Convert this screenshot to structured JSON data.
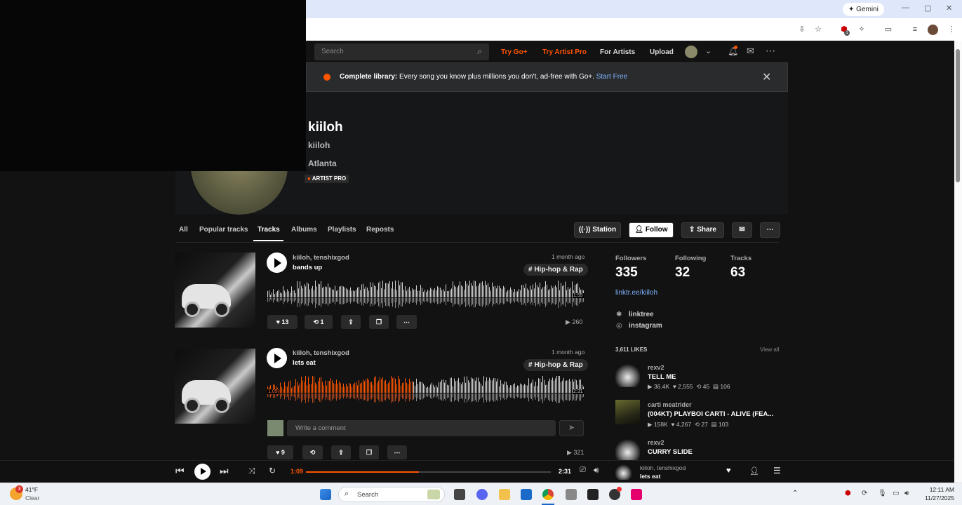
{
  "browser": {
    "gemini_label": "Gemini",
    "extension_badge": "1"
  },
  "nav": {
    "search_placeholder": "Search",
    "try_go_plus": "Try Go+",
    "try_artist_pro": "Try Artist Pro",
    "for_artists": "For Artists",
    "upload": "Upload"
  },
  "banner": {
    "bold": "Complete library:",
    "text": "Every song you know plus millions you don't, ad-free with Go+.",
    "link": "Start Free"
  },
  "profile": {
    "name": "kiiloh",
    "username": "kiiloh",
    "location": "Atlanta",
    "badge": "ARTIST PRO"
  },
  "tabs": [
    "All",
    "Popular tracks",
    "Tracks",
    "Albums",
    "Playlists",
    "Reposts"
  ],
  "actions": {
    "station": "Station",
    "follow": "Follow",
    "share": "Share"
  },
  "tracks": [
    {
      "artist": "kiiloh, tenshixgod",
      "title": "bands up",
      "ago": "1 month ago",
      "tag": "# Hip-hop & Rap",
      "duration": "1:55",
      "likes": "13",
      "reposts": "1",
      "plays": "260"
    },
    {
      "artist": "kiiloh, tenshixgod",
      "title": "lets eat",
      "ago": "1 month ago",
      "tag": "# Hip-hop & Rap",
      "position": "1:09",
      "duration": "2:31",
      "progress": 0.46,
      "likes": "9",
      "plays": "321"
    }
  ],
  "comment_placeholder": "Write a comment",
  "stats": {
    "followers_label": "Followers",
    "followers": "335",
    "following_label": "Following",
    "following": "32",
    "tracks_label": "Tracks",
    "tracks": "63"
  },
  "links": {
    "website": "linktr.ee/kiiloh",
    "linktree": "linktree",
    "instagram": "instagram"
  },
  "likes_panel": {
    "header": "3,611 LIKES",
    "view_all": "View all",
    "items": [
      {
        "artist": "rexv2",
        "title": "TELL ME",
        "plays": "36.4K",
        "likes": "2,555",
        "reposts": "45",
        "comments": "106"
      },
      {
        "artist": "carti meatrider",
        "title": "(004KT) PLAYBOI CARTI - ALIVE (FEA...",
        "plays": "158K",
        "likes": "4,267",
        "reposts": "27",
        "comments": "103"
      },
      {
        "artist": "rexv2",
        "title": "CURRY SLIDE"
      }
    ]
  },
  "player": {
    "current": "1:09",
    "duration": "2:31",
    "progress": 0.46,
    "artist": "kiiloh, tenshixgod",
    "title": "lets eat"
  },
  "taskbar": {
    "weather_temp": "41°F",
    "weather_desc": "Clear",
    "weather_badge": "3",
    "search": "Search",
    "time": "12:11 AM",
    "date": "11/27/2025"
  },
  "colors": {
    "accent": "#ff5500",
    "link": "#7fb3ff"
  }
}
